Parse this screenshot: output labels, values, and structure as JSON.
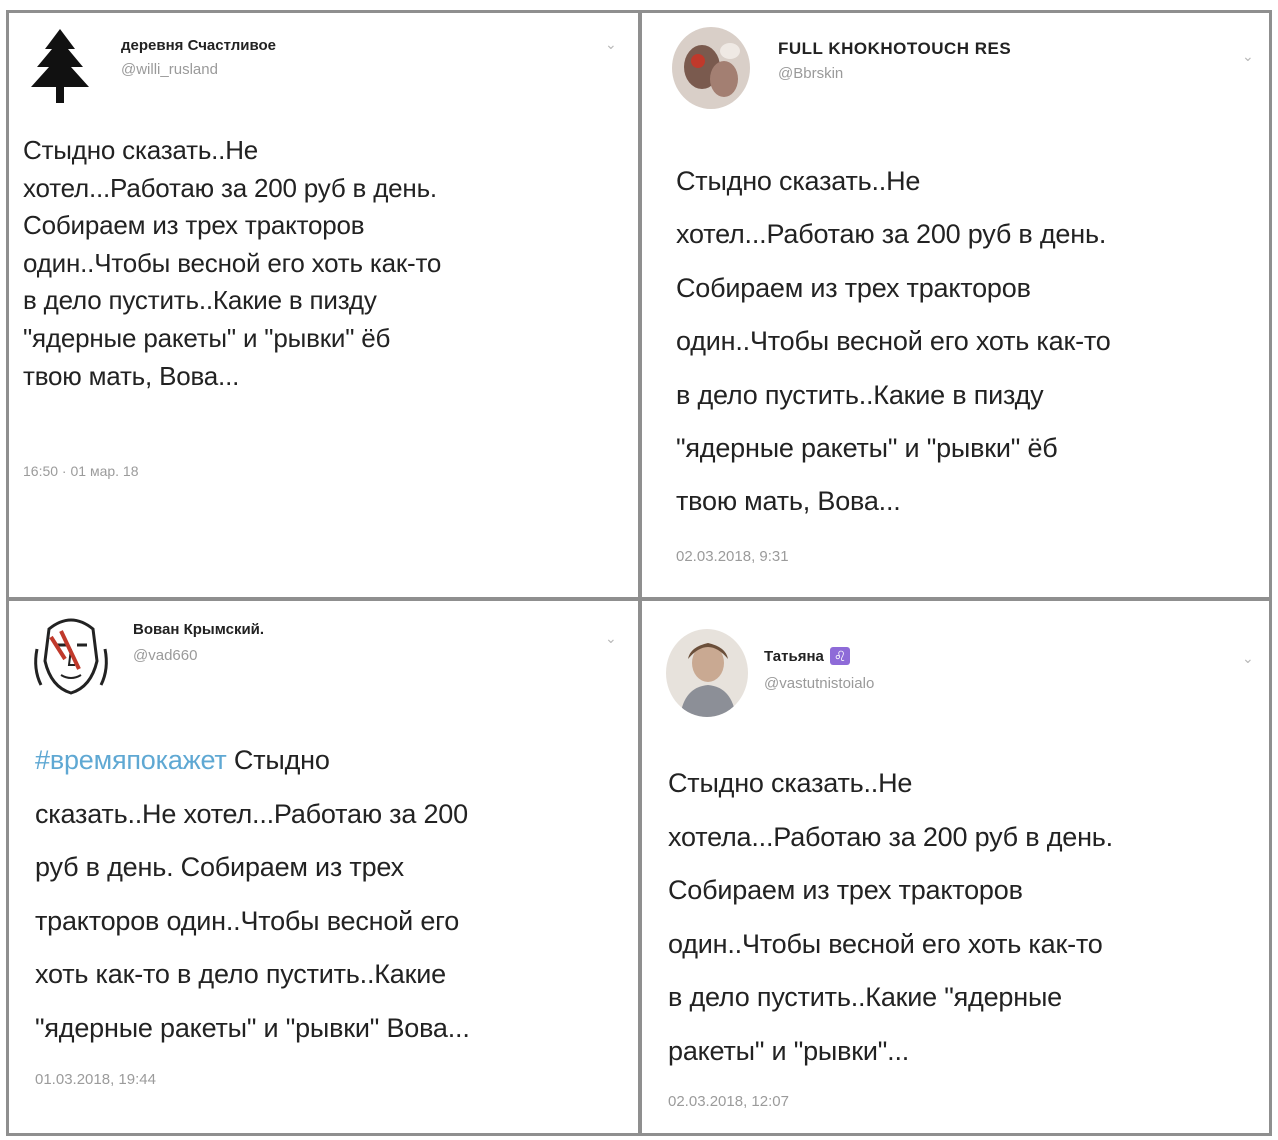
{
  "tweets": [
    {
      "name": "деревня Счастливое",
      "handle": "@willi_rusland",
      "avatar_icon": "pine-tree-icon",
      "text": "Стыдно сказать..Не\nхотел...Работаю за 200 руб в день.\nСобираем из трех тракторов\nодин..Чтобы весной его хоть как-то\nв дело пустить..Какие в пизду\n\"ядерные ракеты\" и \"рывки\" ёб\nтвою мать, Вова...",
      "time": "16:50 · 01 мар. 18"
    },
    {
      "name": "FULL KHOKHOTOUCH RES",
      "handle": "@Bbrskin",
      "avatar_icon": "photo-avatar-icon",
      "text": "Стыдно сказать..Не\nхотел...Работаю за 200 руб в день.\nСобираем из трех  тракторов\nодин..Чтобы весной его хоть как-то\nв дело пустить..Какие в  пизду\n\"ядерные ракеты\" и \"рывки\" ёб\nтвою мать, Вова...",
      "time": "02.03.2018, 9:31"
    },
    {
      "name": "Вован Крымский.",
      "handle": "@vad660",
      "avatar_icon": "face-sketch-icon",
      "hashtag": "#времяпокажет",
      "text": " Стыдно\nсказать..Не хотел...Работаю за 200\nруб в день. Собираем из трех\nтракторов один..Чтобы весной его\nхоть как-то в дело пустить..Какие\n\"ядерные ракеты\" и \"рывки\"  Вова...",
      "time": "01.03.2018, 19:44"
    },
    {
      "name": "Татьяна",
      "name_badge": "♌",
      "handle": "@vastutnistoialo",
      "avatar_icon": "woman-photo-icon",
      "text": "Стыдно сказать..Не\nхотела...Работаю за 200 руб в день.\nСобираем из трех  тракторов\nодин..Чтобы весной его хоть как-то\nв дело пустить..Какие  \"ядерные\nракеты\" и \"рывки\"...",
      "time": "02.03.2018, 12:07"
    }
  ],
  "colors": {
    "hashtag": "#5fa8d3",
    "badge": "#8e6bd8",
    "border": "#8f8f8f"
  }
}
